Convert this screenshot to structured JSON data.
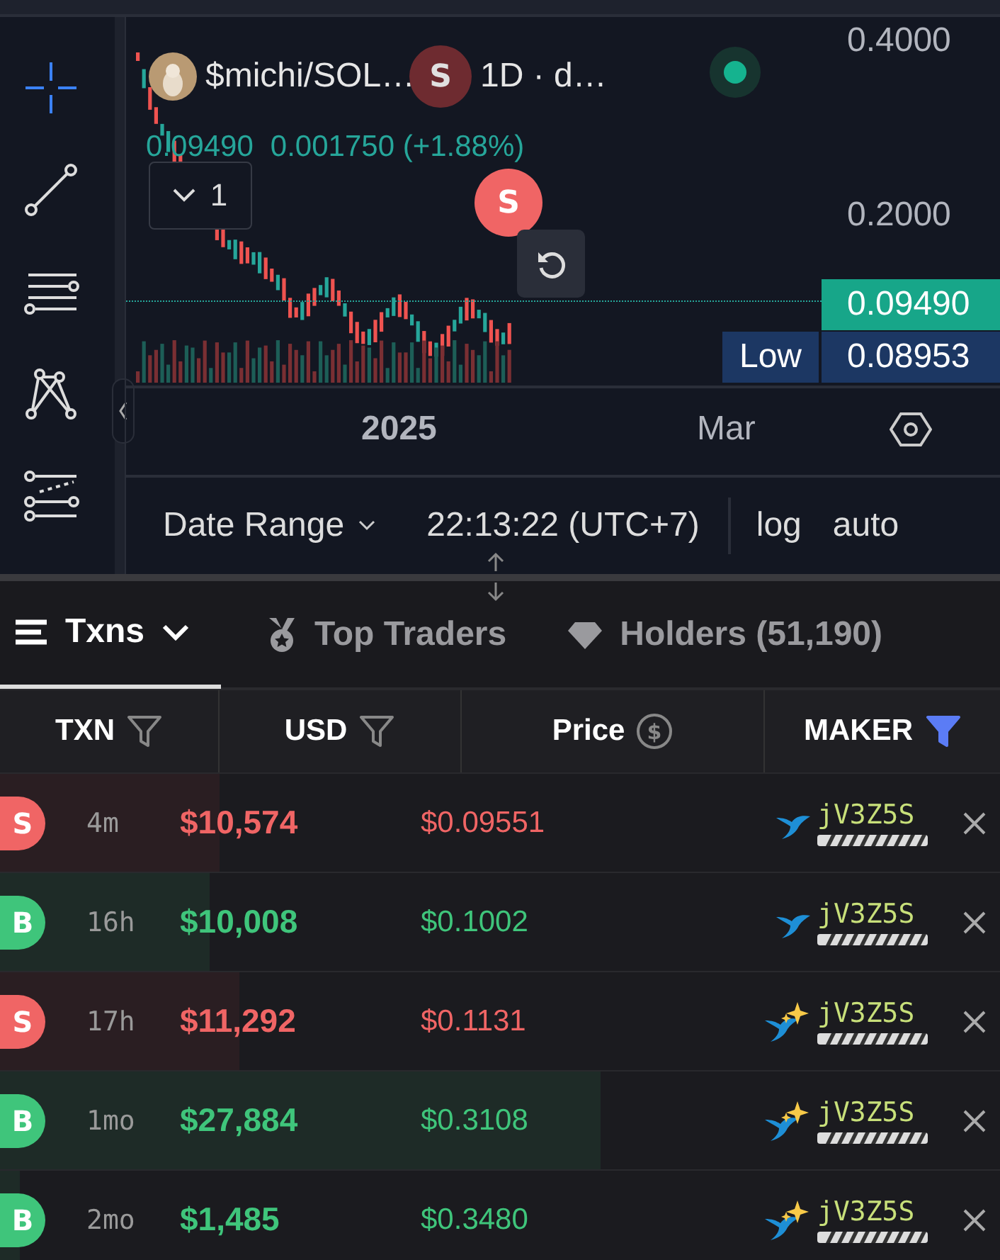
{
  "chart": {
    "symbol": "$michi/SOL…",
    "interval": "1D · d…",
    "live": true,
    "last": "0.09490",
    "change": "0.001750 (+1.88%)",
    "collapse_count": "1",
    "markers": [
      {
        "label": "S",
        "kind": "sell",
        "faded": true
      },
      {
        "label": "S",
        "kind": "sell",
        "faded": false
      }
    ],
    "price_ticks": [
      "0.4000",
      "0.2000"
    ],
    "current_price": "0.09490",
    "low_label": "Low",
    "low_price": "0.08953",
    "time_labels": [
      {
        "label": "2025",
        "bold": true
      },
      {
        "label": "Mar",
        "bold": false
      }
    ],
    "date_range": "Date Range",
    "clock": "22:13:22 (UTC+7)",
    "scale_buttons": [
      "log",
      "auto"
    ]
  },
  "tabs": [
    {
      "label": "Txns",
      "selected": true
    },
    {
      "label": "Top Traders",
      "selected": false
    },
    {
      "label": "Holders (51,190)",
      "selected": false
    }
  ],
  "table": {
    "columns": [
      {
        "label": "TXN",
        "filtered": false
      },
      {
        "label": "USD",
        "filtered": false
      },
      {
        "label": "Price",
        "filtered": false,
        "icon": "$"
      },
      {
        "label": "MAKER",
        "filtered": true
      }
    ],
    "rows": [
      {
        "side": "S",
        "kind": "sell",
        "age": "4m",
        "usd": "$10,574",
        "price": "$0.09551",
        "maker": {
          "address": "jV3Z5S",
          "kind": "whale"
        },
        "level": 0.22
      },
      {
        "side": "B",
        "kind": "buy",
        "age": "16h",
        "usd": "$10,008",
        "price": "$0.1002",
        "maker": {
          "address": "jV3Z5S",
          "kind": "whale"
        },
        "level": 0.21
      },
      {
        "side": "S",
        "kind": "sell",
        "age": "17h",
        "usd": "$11,292",
        "price": "$0.1131",
        "maker": {
          "address": "jV3Z5S",
          "kind": "whale_sparkle"
        },
        "level": 0.24
      },
      {
        "side": "B",
        "kind": "buy",
        "age": "1mo",
        "usd": "$27,884",
        "price": "$0.3108",
        "maker": {
          "address": "jV3Z5S",
          "kind": "whale_sparkle"
        },
        "level": 0.6
      },
      {
        "side": "B",
        "kind": "buy",
        "age": "2mo",
        "usd": "$1,485",
        "price": "$0.3480",
        "maker": {
          "address": "jV3Z5S",
          "kind": "whale_sparkle"
        },
        "level": 0.02
      }
    ]
  }
}
